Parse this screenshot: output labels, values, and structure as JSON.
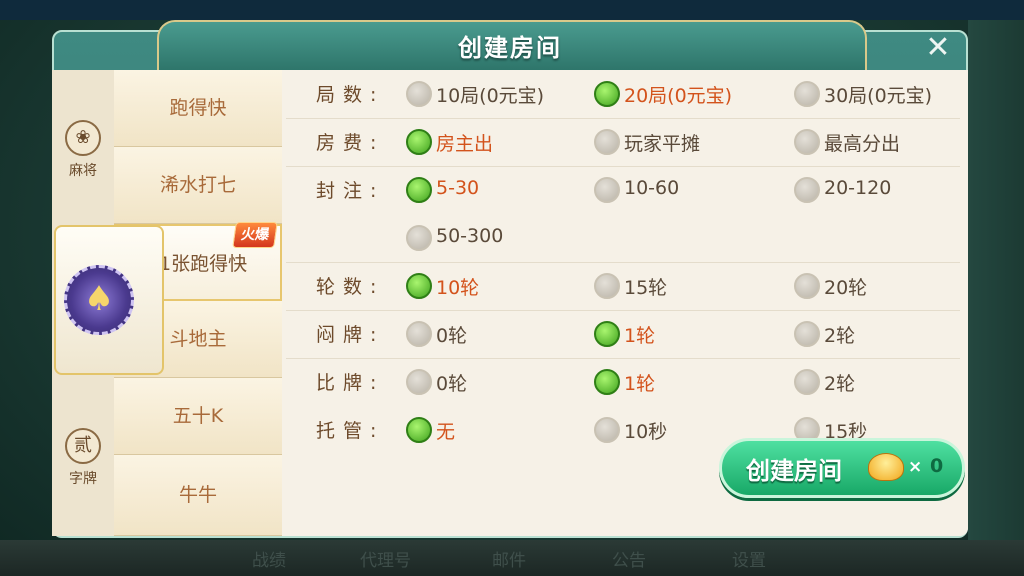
{
  "dialog": {
    "title": "创建房间",
    "close_glyph": "✕"
  },
  "categories": [
    {
      "label": "麻将",
      "icon": "mahjong-medal-icon"
    },
    {
      "label": "",
      "icon": "poker-spade-chip-icon"
    },
    {
      "label": "字牌",
      "icon": "zipai-medal-icon",
      "glyph": "贰"
    }
  ],
  "games": [
    {
      "label": "跑得快",
      "selected": false
    },
    {
      "label": "浠水打七",
      "selected": false
    },
    {
      "label": "11张跑得快",
      "selected": true,
      "badge": "火爆"
    },
    {
      "label": "斗地主",
      "selected": false
    },
    {
      "label": "五十K",
      "selected": false
    },
    {
      "label": "牛牛",
      "selected": false
    }
  ],
  "options": [
    {
      "label": "局数:",
      "choices": [
        {
          "text": "10局(0元宝)",
          "checked": false
        },
        {
          "text": "20局(0元宝)",
          "checked": true
        },
        {
          "text": "30局(0元宝)",
          "checked": false
        }
      ]
    },
    {
      "label": "房费:",
      "choices": [
        {
          "text": "房主出",
          "checked": true
        },
        {
          "text": "玩家平摊",
          "checked": false
        },
        {
          "text": "最高分出",
          "checked": false
        }
      ]
    },
    {
      "label": "封注:",
      "choices": [
        {
          "text": "5-30",
          "checked": true
        },
        {
          "text": "10-60",
          "checked": false
        },
        {
          "text": "20-120",
          "checked": false
        }
      ]
    },
    {
      "label": "",
      "choices": [
        {
          "text": "50-300",
          "checked": false
        }
      ]
    },
    {
      "label": "轮数:",
      "choices": [
        {
          "text": "10轮",
          "checked": true
        },
        {
          "text": "15轮",
          "checked": false
        },
        {
          "text": "20轮",
          "checked": false
        }
      ]
    },
    {
      "label": "闷牌:",
      "choices": [
        {
          "text": "0轮",
          "checked": false
        },
        {
          "text": "1轮",
          "checked": true
        },
        {
          "text": "2轮",
          "checked": false
        }
      ]
    },
    {
      "label": "比牌:",
      "choices": [
        {
          "text": "0轮",
          "checked": false
        },
        {
          "text": "1轮",
          "checked": true
        },
        {
          "text": "2轮",
          "checked": false
        }
      ]
    },
    {
      "label": "托管:",
      "choices": [
        {
          "text": "无",
          "checked": true
        },
        {
          "text": "10秒",
          "checked": false
        },
        {
          "text": "15秒",
          "checked": false
        }
      ]
    }
  ],
  "create_button": {
    "label": "创建房间",
    "times": "×",
    "cost": "0"
  },
  "bottom_bar": [
    "战绩",
    "代理号",
    "邮件",
    "公告",
    "设置"
  ],
  "colors": {
    "checked_text": "#d3531c",
    "checked_radio": "#3fa21d",
    "title_bar": "#3f8a82",
    "create_button": "#18a867"
  }
}
